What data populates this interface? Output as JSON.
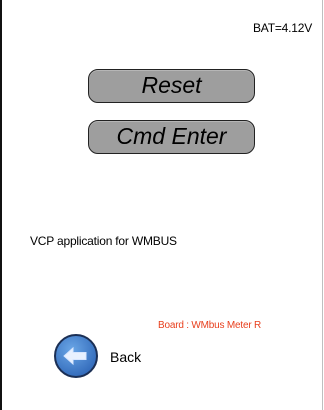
{
  "status": {
    "battery": "BAT=4.12V"
  },
  "buttons": {
    "reset": "Reset",
    "cmd_enter": "Cmd Enter"
  },
  "app": {
    "description": "VCP application for WMBUS"
  },
  "board": {
    "info": "Board : WMbus Meter R"
  },
  "nav": {
    "back_label": "Back"
  },
  "colors": {
    "button_fill": "#9e9e9e",
    "board_text": "#e8401e",
    "back_icon_fill": "#3f7fc8"
  }
}
